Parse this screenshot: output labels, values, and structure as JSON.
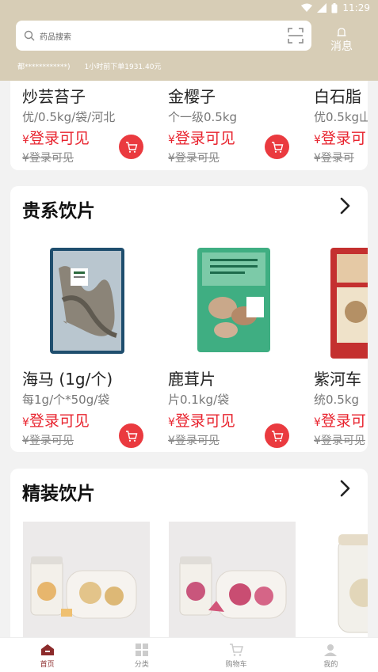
{
  "status": {
    "time": "11:29"
  },
  "header": {
    "search_placeholder": "药品搜索",
    "message_label": "消息",
    "notice_user": "都************)",
    "notice_text": "1小时前下单1931.40元"
  },
  "top_row": {
    "items": [
      {
        "name": "炒芸苔子",
        "spec": "优/0.5kg/袋/河北",
        "price_symbol": "¥",
        "price": "登录可见",
        "orig_symbol": "¥",
        "orig": "登录可见"
      },
      {
        "name": "金樱子",
        "spec": "个一级0.5kg",
        "price_symbol": "¥",
        "price": "登录可见",
        "orig_symbol": "¥",
        "orig": "登录可见"
      },
      {
        "name": "白石脂",
        "spec": "优0.5kg山",
        "price_symbol": "¥",
        "price": "登录可",
        "orig_symbol": "¥",
        "orig": "登录可"
      }
    ]
  },
  "section_gui": {
    "title": "贵系饮片",
    "items": [
      {
        "name": "海马 (1g/个)",
        "spec": "每1g/个*50g/袋",
        "price_symbol": "¥",
        "price": "登录可见",
        "orig_symbol": "¥",
        "orig": "登录可见"
      },
      {
        "name": "鹿茸片",
        "spec": "片0.1kg/袋",
        "price_symbol": "¥",
        "price": "登录可见",
        "orig_symbol": "¥",
        "orig": "登录可见"
      },
      {
        "name": "紫河车",
        "spec": "统0.5kg",
        "price_symbol": "¥",
        "price": "登录可",
        "orig_symbol": "¥",
        "orig": "登录可见"
      }
    ]
  },
  "section_jing": {
    "title": "精装饮片"
  },
  "tabbar": {
    "tabs": [
      {
        "label": "首页",
        "icon": "home-icon",
        "active": true
      },
      {
        "label": "分类",
        "icon": "category-icon",
        "active": false
      },
      {
        "label": "购物车",
        "icon": "cart-icon",
        "active": false
      },
      {
        "label": "我的",
        "icon": "user-icon",
        "active": false
      }
    ]
  },
  "colors": {
    "header": "#d7cdb6",
    "price": "#e8232e",
    "cart_button": "#ea3a3f",
    "active_tab": "#8c2b2b"
  }
}
